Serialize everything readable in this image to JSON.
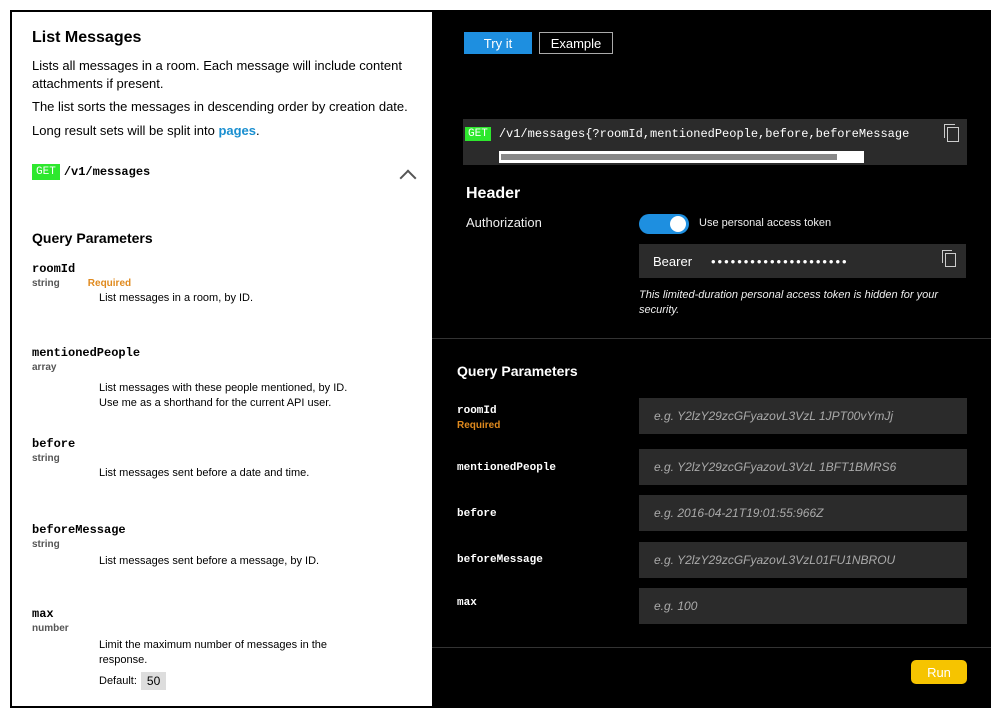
{
  "left": {
    "title": "List Messages",
    "desc1": "Lists all messages in a room. Each message will include content attachments if present.",
    "desc2": "The list sorts the messages in descending order by creation date.",
    "desc3_prefix": "Long result sets will be split into ",
    "desc3_link": "pages",
    "desc3_suffix": ".",
    "method": "GET",
    "path": "/v1/messages",
    "query_title": "Query Parameters",
    "params": [
      {
        "name": "roomId",
        "type": "string",
        "required": "Required",
        "desc": "List messages in a room, by ID."
      },
      {
        "name": "mentionedPeople",
        "type": "array",
        "desc": "List messages with these people mentioned, by ID. Use me as a shorthand for the current API user."
      },
      {
        "name": "before",
        "type": "string",
        "desc": "List messages sent before a date and time."
      },
      {
        "name": "beforeMessage",
        "type": "string",
        "desc": "List messages sent before a message, by ID."
      },
      {
        "name": "max",
        "type": "number",
        "desc": "Limit the maximum number of messages in the response.",
        "default_label": "Default:",
        "default_value": "50"
      }
    ]
  },
  "right": {
    "tab_try": "Try it",
    "tab_example": "Example",
    "request_method": "GET",
    "request_path": "/v1/messages{?roomId,mentionedPeople,before,beforeMessage",
    "header_title": "Header",
    "auth_label": "Authorization",
    "toggle_label": "Use personal access token",
    "bearer_label": "Bearer",
    "bearer_dots": "•••••••••••••••••••••",
    "token_note": "This limited-duration personal access token is hidden for your security.",
    "query_title": "Query Parameters",
    "fields": [
      {
        "name": "roomId",
        "required": "Required",
        "placeholder": "e.g. Y2lzY29zcGFyazovL3VzL 1JPT00vYmJj"
      },
      {
        "name": "mentionedPeople",
        "placeholder": "e.g. Y2lzY29zcGFyazovL3VzL 1BFT1BMRS6"
      },
      {
        "name": "before",
        "placeholder": "e.g. 2016-04-21T19:01:55:966Z"
      },
      {
        "name": "beforeMessage",
        "placeholder": "e.g. Y2lzY29zcGFyazovL3VzL01FU1NBROU"
      },
      {
        "name": "max",
        "placeholder": "e.g. 100"
      }
    ],
    "run_label": "Run"
  },
  "colors": {
    "accent_blue": "#1e8fe0",
    "get_green": "#2ee82e",
    "required_orange": "#e08a1e",
    "run_yellow": "#f6c400"
  }
}
